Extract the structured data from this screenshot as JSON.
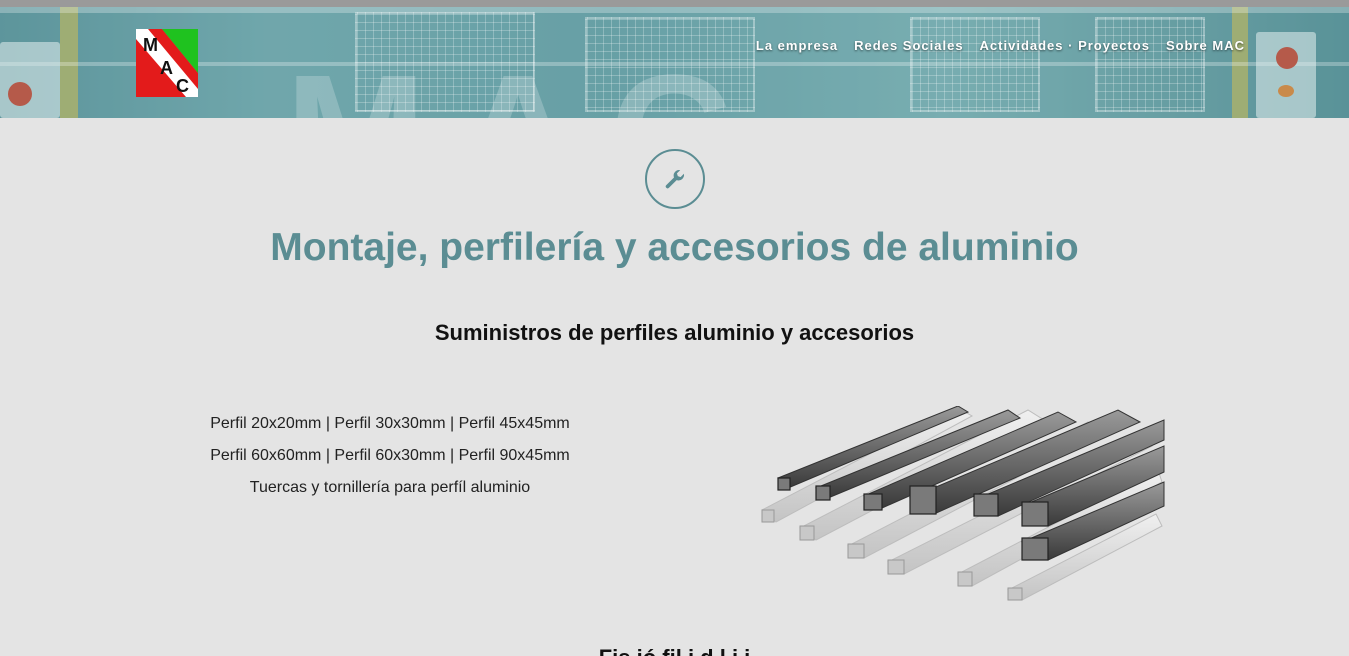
{
  "logo": {
    "letters": [
      "M",
      "A",
      "C"
    ],
    "colors": {
      "green": "#1fc21f",
      "red": "#e31b1b",
      "white": "#ffffff"
    }
  },
  "nav": {
    "items": [
      "La empresa",
      "Redes Sociales",
      "Actividades · Proyectos",
      "Sobre MAC"
    ]
  },
  "section_icon": "wrench-icon",
  "main": {
    "title": "Montaje, perfilería y accesorios de aluminio",
    "subtitle": "Suministros de perfiles aluminio y accesorios",
    "lines": [
      "Perfil 20x20mm | Perfil 30x30mm | Perfil 45x45mm",
      "Perfil 60x60mm | Perfil 60x30mm | Perfil 90x45mm",
      "Tuercas y tornillería para perfíl aluminio"
    ],
    "next_heading": "Fis   ió      fil      i        d   l   i i   "
  },
  "colors": {
    "accent": "#5b8d93",
    "background": "#e4e4e4",
    "topbar": "#9a9a9a"
  }
}
